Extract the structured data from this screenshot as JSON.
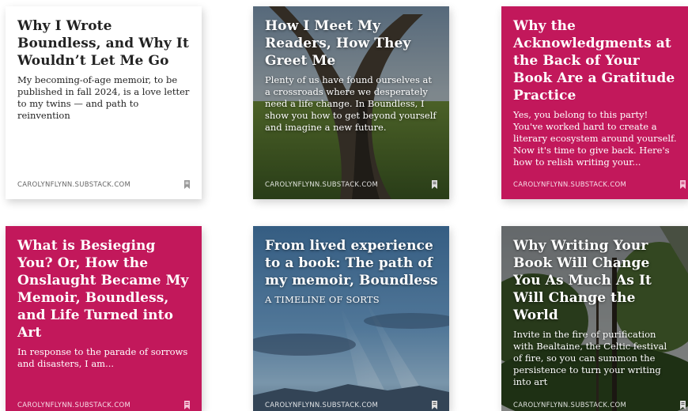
{
  "cards": [
    {
      "title": "Why I Wrote Boundless, and Why It Wouldn’t Let Me Go",
      "description": "My becoming-of-age memoir, to be published in fall 2024, is a love letter to my twins — and path to reinvention",
      "source": "CAROLYNFLYNN.SUBSTACK.COM"
    },
    {
      "title": "How I Meet My Readers, How They Greet Me",
      "description": "Plenty of us have found ourselves at a crossroads where we desperately need a life change. In Boundless, I show you how to get beyond yourself and imagine a new future.",
      "source": "CAROLYNFLYNN.SUBSTACK.COM"
    },
    {
      "title": "Why the Acknowledgments at the Back of Your Book Are a Gratitude Practice",
      "description": "Yes, you belong to this party! You've worked hard to create a literary ecosystem around yourself. Now it's time to give back. Here's how to relish writing your...",
      "source": "CAROLYNFLYNN.SUBSTACK.COM"
    },
    {
      "title": "What is Besieging You? Or, How the Onslaught Became My Memoir, Boundless, and Life Turned into Art",
      "description": "In response to the parade of sorrows and disasters, I am...",
      "source": "CAROLYNFLYNN.SUBSTACK.COM"
    },
    {
      "title": "From lived experience to a book: The path of my memoir, Boundless",
      "description": "A TIMELINE OF SORTS",
      "source": "CAROLYNFLYNN.SUBSTACK.COM"
    },
    {
      "title": "Why Writing Your Book Will Change You As Much As It Will Change the World",
      "description": "Invite in the fire of purification with Bealtaine, the Celtic festival of fire, so you can summon the persistence to turn your writing into art",
      "source": "CAROLYNFLYNN.SUBSTACK.COM"
    }
  ],
  "colors": {
    "accent": "#c2185b",
    "card_white": "#ffffff"
  },
  "icons": {
    "save": "bookmark-icon"
  }
}
